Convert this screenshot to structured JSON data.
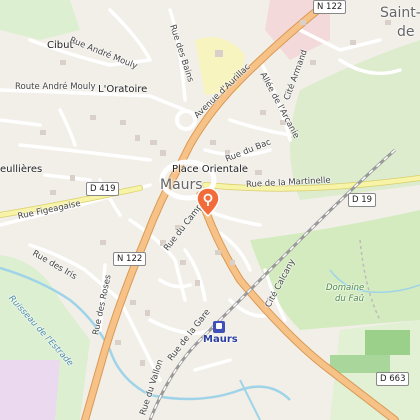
{
  "map": {
    "labels": {
      "saint": "Saint-C",
      "saint2": "de",
      "cibut": "Cibut",
      "rue_andre_mouly": "Rue André Mouly",
      "route_andre_mouly": "Route André Mouly",
      "oratoire": "L'Oratoire",
      "rue_des_bains": "Rue des Bains",
      "avenue_aurillac": "Avenue d'Aurillac",
      "allee_arcanie": "Allée de l'Arcanie",
      "cite_armand": "Cité Armand",
      "place_orientale": "Place Orientale",
      "rue_du_bac": "Rue du Bac",
      "maurs_town": "Maurs",
      "rue_martinelle": "Rue de la Martinelle",
      "ulieres": "eullières",
      "rue_figeagaise": "Rue Figeagaise",
      "rue_du_camp": "Rue du Camp",
      "rue_des_iris": "Rue des Iris",
      "rue_des_roses": "Rue des Roses",
      "cite_calcany": "Cité Calcany",
      "domaine": "Domaine",
      "du_fau": "du Faû",
      "ruisseau": "Ruisseau de l'Estrade",
      "rue_de_la_gare": "Rue de la Gare",
      "rue_du_vallon": "Rue du Vallon",
      "station": "Maurs"
    },
    "shields": {
      "n122_top": "N 122",
      "d419": "D 419",
      "d19": "D 19",
      "n122": "N 122",
      "d663": "D 663"
    },
    "colors": {
      "background": "#f2efe9",
      "major_road": "#f6c288",
      "secondary_road": "#f7f3a7",
      "minor_road": "#ffffff",
      "water": "#9fd4e8",
      "forest": "#d7ecc2",
      "railway": "#888888",
      "marker": "#f26b3a"
    },
    "marker_icon": "map-pin-icon"
  }
}
